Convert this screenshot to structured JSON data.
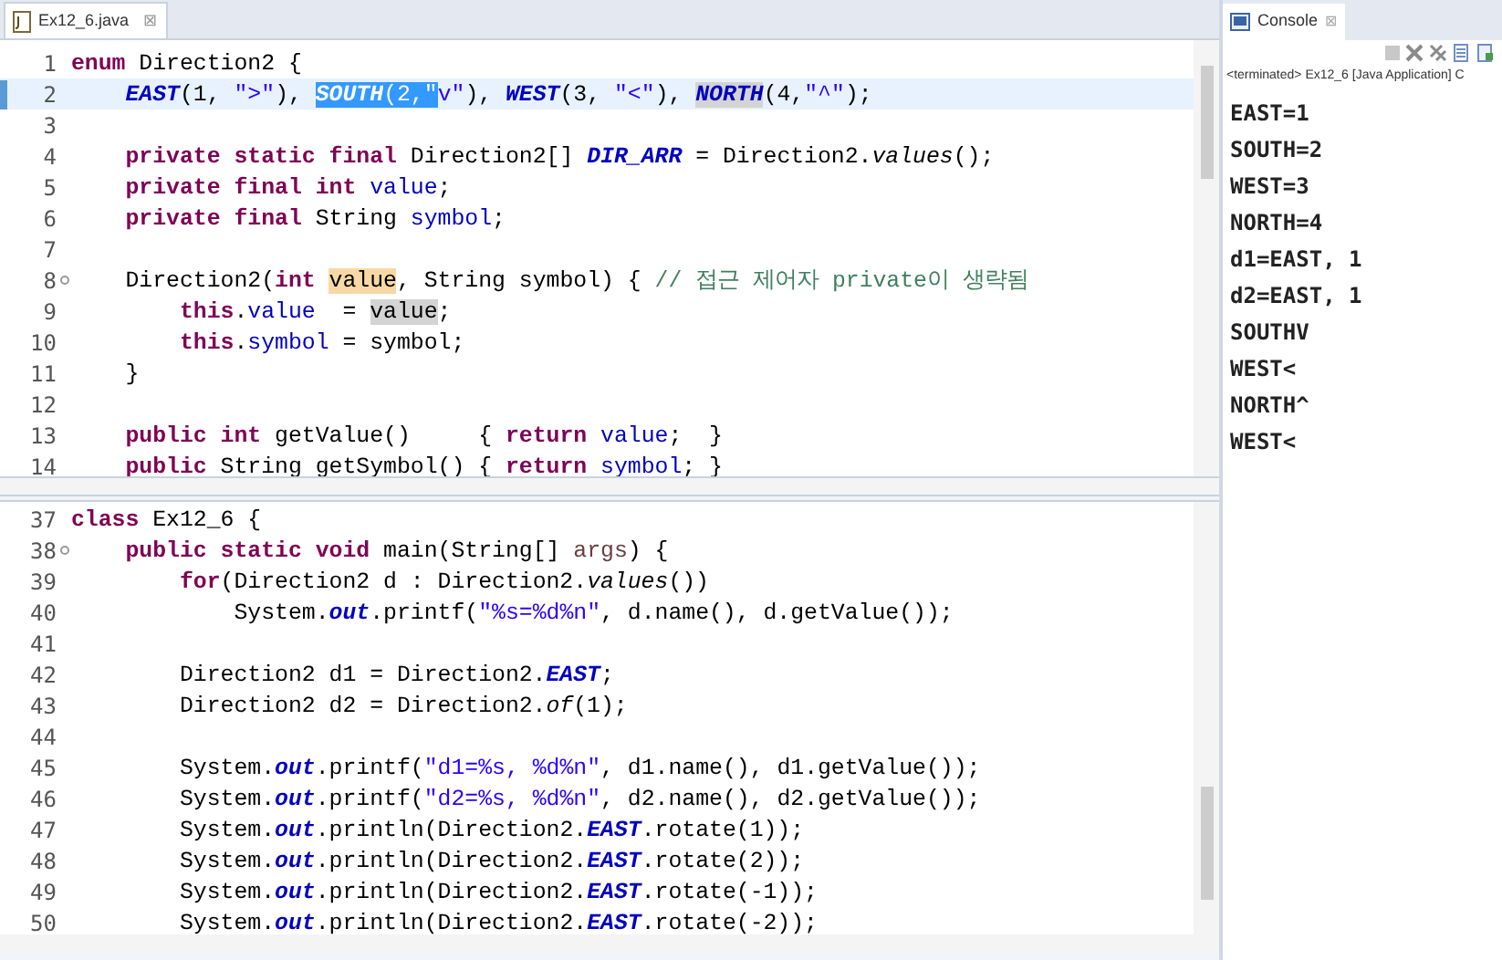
{
  "editor": {
    "tab": {
      "title": "Ex12_6.java",
      "close": "⊠"
    },
    "top_pane": {
      "lines": [
        {
          "number": "1",
          "current": false,
          "tokens": [
            {
              "text": "enum",
              "kind": "keyword"
            },
            {
              "text": " Direction2 {",
              "kind": "plain"
            }
          ]
        },
        {
          "number": "2",
          "current": true,
          "tokens": [
            {
              "text": "    EAST",
              "kind": "constant"
            },
            {
              "text": "(1, ",
              "kind": "plain"
            },
            {
              "text": "\">\"",
              "kind": "string"
            },
            {
              "text": "), ",
              "kind": "plain"
            },
            {
              "text": "SOUTH",
              "kind": "constant",
              "color": "#3399ff"
            },
            {
              "text": "(2,",
              "kind": "plain",
              "color": "#3399ff"
            },
            {
              "text": "\"",
              "kind": "string",
              "color": "#3399ff"
            },
            {
              "text": "v\"",
              "kind": "string"
            },
            {
              "text": "), ",
              "kind": "plain"
            },
            {
              "text": "WEST",
              "kind": "constant"
            },
            {
              "text": "(3, ",
              "kind": "plain"
            },
            {
              "text": "\"<\"",
              "kind": "string"
            },
            {
              "text": "), ",
              "kind": "plain"
            },
            {
              "text": "NORTH",
              "kind": "constant",
              "color": "#d4d4d4"
            },
            {
              "text": "(4,",
              "kind": "plain"
            },
            {
              "text": "\"^\"",
              "kind": "string"
            },
            {
              "text": ");",
              "kind": "plain"
            }
          ]
        },
        {
          "number": "3",
          "current": false
        },
        {
          "number": "4",
          "current": false,
          "tokens": [
            {
              "text": "    private static final",
              "kind": "keyword"
            },
            {
              "text": " Direction2[] ",
              "kind": "plain"
            },
            {
              "text": "DIR_ARR",
              "kind": "constant"
            },
            {
              "text": " = Direction2.",
              "kind": "plain"
            },
            {
              "text": "values",
              "kind": "static-method"
            },
            {
              "text": "();",
              "kind": "plain"
            }
          ]
        },
        {
          "number": "5",
          "current": false,
          "tokens": [
            {
              "text": "    private final int ",
              "kind": "keyword"
            },
            {
              "text": "value",
              "kind": "field"
            },
            {
              "text": ";",
              "kind": "plain"
            }
          ]
        },
        {
          "number": "6",
          "current": false,
          "tokens": [
            {
              "text": "    private final",
              "kind": "keyword"
            },
            {
              "text": " String ",
              "kind": "plain"
            },
            {
              "text": "symbol",
              "kind": "field"
            },
            {
              "text": ";",
              "kind": "plain"
            }
          ]
        },
        {
          "number": "7",
          "current": false
        },
        {
          "number": "8",
          "current": false,
          "foldable": true,
          "tokens": [
            {
              "text": "    Direction2(",
              "kind": "plain"
            },
            {
              "text": "int ",
              "kind": "keyword"
            },
            {
              "text": "value",
              "kind": "plain",
              "color": "#f8d9a5"
            },
            {
              "text": ", String symbol) { ",
              "kind": "plain"
            },
            {
              "text": "// 접근 제어자 private이 생략됨",
              "kind": "comment"
            }
          ]
        },
        {
          "number": "9",
          "current": false,
          "tokens": [
            {
              "text": "        this",
              "kind": "keyword"
            },
            {
              "text": ".",
              "kind": "plain"
            },
            {
              "text": "value",
              "kind": "field"
            },
            {
              "text": "  = ",
              "kind": "plain"
            },
            {
              "text": "value",
              "kind": "plain",
              "color": "#d4d4d4"
            },
            {
              "text": ";",
              "kind": "plain"
            }
          ]
        },
        {
          "number": "10",
          "current": false,
          "tokens": [
            {
              "text": "        this",
              "kind": "keyword"
            },
            {
              "text": ".",
              "kind": "plain"
            },
            {
              "text": "symbol",
              "kind": "field"
            },
            {
              "text": " = symbol;",
              "kind": "plain"
            }
          ]
        },
        {
          "number": "11",
          "current": false,
          "tokens": [
            {
              "text": "    }",
              "kind": "plain"
            }
          ]
        },
        {
          "number": "12",
          "current": false
        },
        {
          "number": "13",
          "current": false,
          "tokens": [
            {
              "text": "    public int",
              "kind": "keyword"
            },
            {
              "text": " getValue()     { ",
              "kind": "plain"
            },
            {
              "text": "return ",
              "kind": "keyword"
            },
            {
              "text": "value",
              "kind": "field"
            },
            {
              "text": ";  }",
              "kind": "plain"
            }
          ]
        },
        {
          "number": "14",
          "current": false,
          "tokens": [
            {
              "text": "    public",
              "kind": "keyword"
            },
            {
              "text": " String getSymbol() { ",
              "kind": "plain"
            },
            {
              "text": "return ",
              "kind": "keyword"
            },
            {
              "text": "symbol",
              "kind": "field"
            },
            {
              "text": "; }",
              "kind": "plain"
            }
          ]
        }
      ]
    },
    "bottom_pane": {
      "lines": [
        {
          "number": "37",
          "current": false,
          "tokens": [
            {
              "text": "class",
              "kind": "keyword"
            },
            {
              "text": " Ex12_6 {",
              "kind": "plain"
            }
          ]
        },
        {
          "number": "38",
          "current": false,
          "foldable": true,
          "tokens": [
            {
              "text": "    public static void",
              "kind": "keyword"
            },
            {
              "text": " main(String[] ",
              "kind": "plain"
            },
            {
              "text": "args",
              "kind": "parameter"
            },
            {
              "text": ") {",
              "kind": "plain"
            }
          ]
        },
        {
          "number": "39",
          "current": false,
          "tokens": [
            {
              "text": "        for",
              "kind": "keyword"
            },
            {
              "text": "(Direction2 d : Direction2.",
              "kind": "plain"
            },
            {
              "text": "values",
              "kind": "static-method"
            },
            {
              "text": "())",
              "kind": "plain"
            }
          ]
        },
        {
          "number": "40",
          "current": false,
          "tokens": [
            {
              "text": "            System.",
              "kind": "plain"
            },
            {
              "text": "out",
              "kind": "constant"
            },
            {
              "text": ".printf(",
              "kind": "plain"
            },
            {
              "text": "\"%s=%d%n\"",
              "kind": "string"
            },
            {
              "text": ", d.name(), d.getValue());",
              "kind": "plain"
            }
          ]
        },
        {
          "number": "41",
          "current": false
        },
        {
          "number": "42",
          "current": false,
          "tokens": [
            {
              "text": "        Direction2 d1 = Direction2.",
              "kind": "plain"
            },
            {
              "text": "EAST",
              "kind": "constant"
            },
            {
              "text": ";",
              "kind": "plain"
            }
          ]
        },
        {
          "number": "43",
          "current": false,
          "tokens": [
            {
              "text": "        Direction2 d2 = Direction2.",
              "kind": "plain"
            },
            {
              "text": "of",
              "kind": "static-method"
            },
            {
              "text": "(1);",
              "kind": "plain"
            }
          ]
        },
        {
          "number": "44",
          "current": false
        },
        {
          "number": "45",
          "current": false,
          "tokens": [
            {
              "text": "        System.",
              "kind": "plain"
            },
            {
              "text": "out",
              "kind": "constant"
            },
            {
              "text": ".printf(",
              "kind": "plain"
            },
            {
              "text": "\"d1=%s, %d%n\"",
              "kind": "string"
            },
            {
              "text": ", d1.name(), d1.getValue());",
              "kind": "plain"
            }
          ]
        },
        {
          "number": "46",
          "current": false,
          "tokens": [
            {
              "text": "        System.",
              "kind": "plain"
            },
            {
              "text": "out",
              "kind": "constant"
            },
            {
              "text": ".printf(",
              "kind": "plain"
            },
            {
              "text": "\"d2=%s, %d%n\"",
              "kind": "string"
            },
            {
              "text": ", d2.name(), d2.getValue());",
              "kind": "plain"
            }
          ]
        },
        {
          "number": "47",
          "current": false,
          "tokens": [
            {
              "text": "        System.",
              "kind": "plain"
            },
            {
              "text": "out",
              "kind": "constant"
            },
            {
              "text": ".println(Direction2.",
              "kind": "plain"
            },
            {
              "text": "EAST",
              "kind": "constant"
            },
            {
              "text": ".rotate(1));",
              "kind": "plain"
            }
          ]
        },
        {
          "number": "48",
          "current": false,
          "tokens": [
            {
              "text": "        System.",
              "kind": "plain"
            },
            {
              "text": "out",
              "kind": "constant"
            },
            {
              "text": ".println(Direction2.",
              "kind": "plain"
            },
            {
              "text": "EAST",
              "kind": "constant"
            },
            {
              "text": ".rotate(2));",
              "kind": "plain"
            }
          ]
        },
        {
          "number": "49",
          "current": false,
          "tokens": [
            {
              "text": "        System.",
              "kind": "plain"
            },
            {
              "text": "out",
              "kind": "constant"
            },
            {
              "text": ".println(Direction2.",
              "kind": "plain"
            },
            {
              "text": "EAST",
              "kind": "constant"
            },
            {
              "text": ".rotate(-1));",
              "kind": "plain"
            }
          ]
        },
        {
          "number": "50",
          "current": false,
          "tokens": [
            {
              "text": "        System.",
              "kind": "plain"
            },
            {
              "text": "out",
              "kind": "constant"
            },
            {
              "text": ".println(Direction2.",
              "kind": "plain"
            },
            {
              "text": "EAST",
              "kind": "constant"
            },
            {
              "text": ".rotate(-2));",
              "kind": "plain"
            }
          ]
        }
      ]
    }
  },
  "console": {
    "tab": {
      "title": "Console",
      "close": "⊠"
    },
    "status": "<terminated> Ex12_6 [Java Application] C",
    "output": [
      "EAST=1",
      "SOUTH=2",
      "WEST=3",
      "NORTH=4",
      "d1=EAST, 1",
      "d2=EAST, 1",
      "SOUTHV",
      "WEST<",
      "NORTH^",
      "WEST<"
    ]
  }
}
